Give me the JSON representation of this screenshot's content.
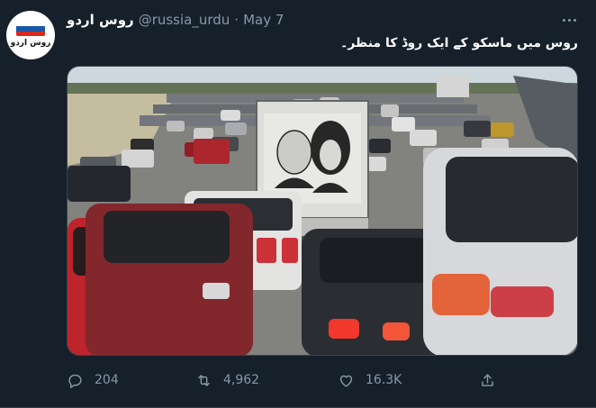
{
  "tweet": {
    "author": {
      "display_name": "روس اردو",
      "handle": "@russia_urdu",
      "avatar_text": "روس اردو"
    },
    "separator": "·",
    "date": "May 7",
    "text": "روس میں ماسکو کے ایک روڈ کا منظر۔",
    "media": {
      "description_icon": "photo"
    },
    "actions": {
      "replies": "204",
      "retweets": "4,962",
      "likes": "16.3K"
    }
  },
  "colors": {
    "background": "#15202b",
    "secondary_text": "#8899a6",
    "border": "#38444d"
  }
}
